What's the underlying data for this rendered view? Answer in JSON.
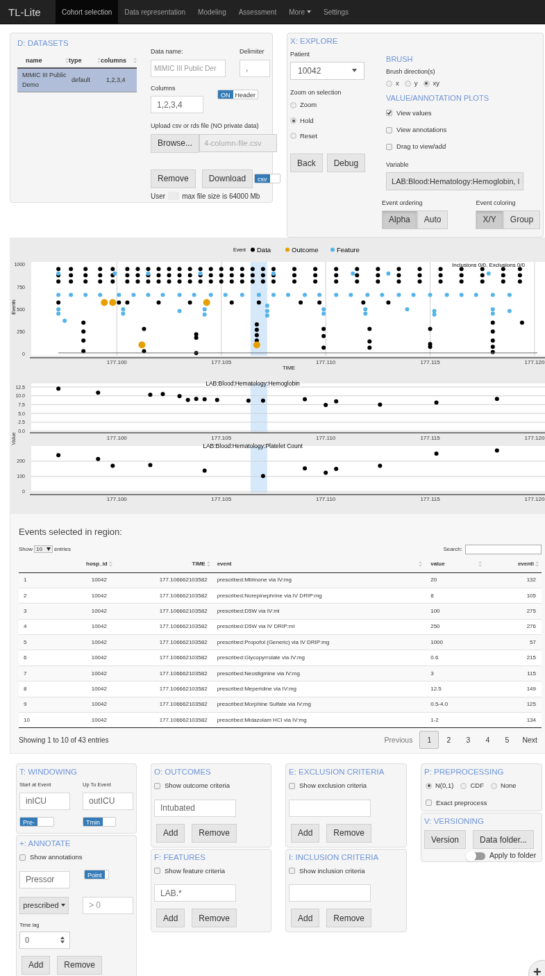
{
  "navbar": {
    "brand": "TL-Lite",
    "items": [
      {
        "label": "Cohort selection",
        "selected": true,
        "kind": "link"
      },
      {
        "label": "Data representation",
        "selected": false,
        "kind": "link"
      },
      {
        "label": "Modeling",
        "selected": false,
        "kind": "link"
      },
      {
        "label": "Assessment",
        "selected": false,
        "kind": "link"
      },
      {
        "label": "More",
        "selected": false,
        "kind": "dropdown"
      },
      {
        "label": "Settings",
        "selected": false,
        "kind": "link"
      }
    ]
  },
  "datasets": {
    "title": "D: DATASETS",
    "columns": [
      "name",
      "type",
      "columns"
    ],
    "rows": [
      {
        "cells": [
          "MIMIC III Public Demo",
          "default",
          "1,2,3,4"
        ],
        "selected": true
      }
    ],
    "data_name": {
      "label": "Data name:",
      "placeholder": "MIMIC III Public Der"
    },
    "delimiter": {
      "label": "Delimiter",
      "value": ","
    },
    "columns_field": {
      "label": "Columns",
      "value": "1,2,3,4"
    },
    "header_toggle": {
      "on_label": "ON",
      "label": "Header",
      "on": true
    },
    "upload": {
      "label": "Upload csv or rds file (NO private data)",
      "button": "Browse...",
      "placeholder": "4-column-file.csv"
    },
    "buttons": [
      "Remove",
      "Download"
    ],
    "format_toggle": {
      "label": "csv",
      "on": true
    },
    "footer": {
      "prefix": "User",
      "text": "max file size is 64000 Mb"
    }
  },
  "explore": {
    "title": "X: EXPLORE",
    "patient": {
      "label": "Patient",
      "value": "10042"
    },
    "zoom": {
      "label": "Zoom on selection",
      "options": [
        {
          "label": "Zoom",
          "selected": false
        },
        {
          "label": "Hold",
          "selected": true
        },
        {
          "label": "Reset",
          "selected": false
        }
      ]
    },
    "buttons": [
      "Back",
      "Debug"
    ],
    "brush": {
      "heading": "BRUSH",
      "label": "Brush direction(s)",
      "options": [
        {
          "label": "x",
          "selected": false
        },
        {
          "label": "y",
          "selected": false
        },
        {
          "label": "xy",
          "selected": true
        }
      ]
    },
    "plots": {
      "heading": "VALUE/ANNOTATION PLOTS",
      "checkboxes": [
        {
          "label": "View values",
          "checked": true
        },
        {
          "label": "View annotations",
          "checked": false
        },
        {
          "label": "Drag to view/add",
          "checked": false
        }
      ]
    },
    "variable": {
      "label": "Variable",
      "value": "LAB:Blood:Hematology:Hemoglobin, l"
    },
    "event_ordering": {
      "label": "Event ordering",
      "options": [
        {
          "label": "Alpha",
          "selected": true
        },
        {
          "label": "Auto",
          "selected": false
        }
      ]
    },
    "event_coloring": {
      "label": "Event coloring",
      "options": [
        {
          "label": "X/Y",
          "selected": true
        },
        {
          "label": "Group",
          "selected": false
        }
      ]
    }
  },
  "events_plot": {
    "legend_title": "Event",
    "note": "Inclusions 0/0, Exclusions 0/0",
    "chart_data": {
      "type": "scatter",
      "xlabel": "TIME",
      "ylabel": "Events",
      "xlim": [
        177.0959,
        177.1205
      ],
      "ylim": [
        -20,
        1030
      ],
      "xticks": [
        {
          "value": 177.1,
          "label": "177.100"
        },
        {
          "value": 177.105,
          "label": "177.105"
        },
        {
          "value": 177.11,
          "label": "177.110"
        },
        {
          "value": 177.115,
          "label": "177.115"
        },
        {
          "value": 177.12,
          "label": "177.120"
        }
      ],
      "yticks": [
        0,
        250,
        500,
        750,
        1000
      ],
      "grid": true,
      "legend": "top",
      "bands": [
        {
          "axis": "x",
          "from": 177.1064,
          "to": 177.1072
        }
      ],
      "series": [
        {
          "name": "Data",
          "color": "#000000",
          "x": [
            177.0972,
            177.0978,
            177.0985,
            177.0992,
            177.0998,
            177.1005,
            177.101,
            177.1015,
            177.102,
            177.1025,
            177.103,
            177.1035,
            177.104,
            177.1045,
            177.105,
            177.1055,
            177.106,
            177.1065,
            177.107,
            177.1075,
            177.1085,
            177.1095,
            177.1105,
            177.1115,
            177.1125,
            177.1135,
            177.1145,
            177.1155,
            177.1165,
            177.1175,
            177.1185,
            177.1193,
            177.0972,
            177.0978,
            177.0985,
            177.0992,
            177.0998,
            177.1005,
            177.101,
            177.1015,
            177.102,
            177.1025,
            177.103,
            177.1035,
            177.104,
            177.1045,
            177.105,
            177.1055,
            177.106,
            177.1065,
            177.107,
            177.1075,
            177.1085,
            177.1095,
            177.1105,
            177.1115,
            177.1125,
            177.1135,
            177.1145,
            177.1155,
            177.1165,
            177.1175,
            177.1185,
            177.1193,
            177.0972,
            177.0978,
            177.0985,
            177.0992,
            177.0998,
            177.1005,
            177.101,
            177.1015,
            177.102,
            177.1025,
            177.103,
            177.1035,
            177.104,
            177.1045,
            177.105,
            177.1055,
            177.106,
            177.1065,
            177.107,
            177.1075,
            177.1085,
            177.1095,
            177.1105,
            177.1115,
            177.1125,
            177.1135,
            177.1145,
            177.1155,
            177.1165,
            177.1175,
            177.1185,
            177.1193,
            177.0972,
            177.1001,
            177.1005,
            177.102,
            177.1035,
            177.1055,
            177.1068,
            177.1088,
            177.1097,
            177.1118,
            177.113,
            177.0984,
            177.0984,
            177.0984,
            177.0984,
            177.1013,
            177.1013,
            177.1038,
            177.1038,
            177.1038,
            177.1067,
            177.1067,
            177.1067,
            177.1067,
            177.1099,
            177.1099,
            177.1099,
            177.1121,
            177.1121,
            177.1121,
            177.115,
            177.115,
            177.115,
            177.118,
            177.118,
            177.118,
            177.118,
            177.118,
            177.1194
          ],
          "values": [
            950,
            950,
            950,
            950,
            950,
            950,
            950,
            950,
            950,
            950,
            950,
            950,
            950,
            950,
            950,
            950,
            950,
            950,
            950,
            950,
            950,
            950,
            950,
            950,
            950,
            950,
            950,
            950,
            950,
            950,
            950,
            950,
            880,
            880,
            880,
            880,
            880,
            880,
            880,
            880,
            880,
            880,
            880,
            880,
            880,
            880,
            880,
            880,
            880,
            880,
            880,
            880,
            880,
            880,
            880,
            880,
            880,
            880,
            880,
            880,
            880,
            880,
            880,
            880,
            810,
            810,
            810,
            810,
            810,
            810,
            810,
            810,
            810,
            810,
            810,
            810,
            810,
            810,
            810,
            810,
            810,
            810,
            810,
            810,
            810,
            810,
            810,
            810,
            810,
            810,
            810,
            810,
            810,
            810,
            810,
            810,
            575,
            575,
            575,
            575,
            575,
            575,
            575,
            575,
            575,
            575,
            575,
            350,
            250,
            150,
            30,
            280,
            30,
            220,
            180,
            10,
            330,
            270,
            210,
            150,
            280,
            200,
            70,
            280,
            140,
            70,
            280,
            110,
            80,
            350,
            250,
            150,
            80,
            20,
            350
          ]
        },
        {
          "name": "Outcome",
          "color": "#e69f00",
          "x": [
            177.0994,
            177.0998,
            177.1043,
            177.1012,
            177.1067
          ],
          "values": [
            575,
            575,
            575,
            100,
            100
          ]
        },
        {
          "name": "Feature",
          "color": "#56b4e9",
          "x": [
            177.0972,
            177.0978,
            177.0985,
            177.0992,
            177.1001,
            177.1008,
            177.1015,
            177.1022,
            177.103,
            177.1037,
            177.1045,
            177.1052,
            177.106,
            177.1068,
            177.1075,
            177.1082,
            177.109,
            177.1097,
            177.1105,
            177.1112,
            177.112,
            177.1127,
            177.1135,
            177.1142,
            177.115,
            177.1158,
            177.1165,
            177.1172,
            177.118,
            177.1188,
            177.0972,
            177.0999,
            177.1015,
            177.104,
            177.1075,
            177.1113,
            177.113,
            177.1178,
            177.0972,
            177.0972,
            177.0975,
            177.1003,
            177.1003,
            177.103,
            177.1042,
            177.1042,
            177.1072,
            177.1072,
            177.1072,
            177.1099,
            177.1099,
            177.1119,
            177.1119,
            177.1139,
            177.1152,
            177.1152,
            177.118,
            177.118,
            177.1188
          ],
          "values": [
            660,
            660,
            660,
            660,
            660,
            660,
            660,
            660,
            660,
            660,
            660,
            660,
            660,
            660,
            660,
            660,
            660,
            660,
            660,
            660,
            660,
            660,
            660,
            660,
            660,
            660,
            660,
            660,
            660,
            660,
            900,
            900,
            900,
            900,
            900,
            900,
            900,
            900,
            500,
            450,
            370,
            500,
            450,
            480,
            500,
            440,
            540,
            480,
            430,
            500,
            450,
            500,
            450,
            500,
            480,
            440,
            500,
            450,
            480
          ]
        }
      ]
    }
  },
  "value_plots": {
    "ylabel": "Value",
    "plots": [
      {
        "title": "LAB:Blood:Hematology:Hemoglobin",
        "chart_data": {
          "type": "scatter",
          "xlim": [
            177.0959,
            177.1205
          ],
          "ylim": [
            -0.3,
            13.5
          ],
          "xticks": [
            {
              "value": 177.1,
              "label": "177.100"
            },
            {
              "value": 177.105,
              "label": "177.105"
            },
            {
              "value": 177.11,
              "label": "177.110"
            },
            {
              "value": 177.115,
              "label": "177.115"
            },
            {
              "value": 177.12,
              "label": "177.120"
            }
          ],
          "yticks": [
            {
              "value": 0,
              "label": "0.0"
            },
            {
              "value": 2.5,
              "label": "2.5"
            },
            {
              "value": 5,
              "label": "5.0"
            },
            {
              "value": 7.5,
              "label": "7.5"
            },
            {
              "value": 10,
              "label": "10.0"
            },
            {
              "value": 12.5,
              "label": "12.5"
            }
          ],
          "grid": true,
          "bands": [
            {
              "axis": "x",
              "from": 177.1064,
              "to": 177.1072
            }
          ],
          "series": [
            {
              "color": "#000000",
              "x": [
                177.0972,
                177.0991,
                177.1016,
                177.1022,
                177.103,
                177.1034,
                177.1038,
                177.1042,
                177.1048,
                177.1063,
                177.107,
                177.109,
                177.11,
                177.1105,
                177.1126,
                177.1153,
                177.1182
              ],
              "values": [
                12.0,
                10.9,
                10.3,
                10.5,
                9.9,
                8.8,
                9.1,
                9.0,
                8.8,
                8.6,
                8.6,
                9.0,
                7.4,
                8.4,
                7.5,
                8.1,
                9.1
              ]
            }
          ]
        }
      },
      {
        "title": "LAB:Blood:Hematology:Platelet Count",
        "chart_data": {
          "type": "scatter",
          "xlim": [
            177.0959,
            177.1205
          ],
          "ylim": [
            -5,
            300
          ],
          "xticks": [
            {
              "value": 177.1,
              "label": "177.100"
            },
            {
              "value": 177.105,
              "label": "177.105"
            },
            {
              "value": 177.11,
              "label": "177.110"
            },
            {
              "value": 177.115,
              "label": "177.115"
            },
            {
              "value": 177.12,
              "label": "177.120"
            }
          ],
          "yticks": [
            0,
            100,
            200
          ],
          "grid": true,
          "bands": [
            {
              "axis": "x",
              "from": 177.1064,
              "to": 177.1072
            }
          ],
          "series": [
            {
              "color": "#000000",
              "x": [
                177.0972,
                177.0991,
                177.0998,
                177.1016,
                177.1042,
                177.107,
                177.109,
                177.11,
                177.1105,
                177.1126,
                177.1153,
                177.1182
              ],
              "values": [
                240,
                215,
                170,
                175,
                138,
                103,
                153,
                125,
                150,
                170,
                250,
                270
              ]
            }
          ]
        }
      }
    ]
  },
  "events_table": {
    "heading": "Events selected in region:",
    "length": {
      "show": "Show",
      "value": "10",
      "entries": "entries"
    },
    "search": {
      "label": "Search:"
    },
    "columns": [
      "",
      "hosp_id",
      "TIME",
      "event",
      "value",
      "eventi"
    ],
    "rows": [
      [
        "1",
        "10042",
        "177.106662103582",
        "prescribed:Milrinone via IV:mg",
        "20",
        "132"
      ],
      [
        "2",
        "10042",
        "177.106662103582",
        "prescribed:Norepinephrine via IV DRIP:mg",
        "8",
        "105"
      ],
      [
        "3",
        "10042",
        "177.106662103582",
        "prescribed:D5W via IV:ml",
        "100",
        "275"
      ],
      [
        "4",
        "10042",
        "177.106662103582",
        "prescribed:D5W via IV DRIP:ml",
        "250",
        "276"
      ],
      [
        "5",
        "10042",
        "177.106662103582",
        "prescribed:Propofol (Generic) via IV DRIP:mg",
        "1000",
        "57"
      ],
      [
        "6",
        "10042",
        "177.106662103582",
        "prescribed:Glycopyrrolate via IV:mg",
        "0.6",
        "215"
      ],
      [
        "7",
        "10042",
        "177.106662103582",
        "prescribed:Neostigmine via IV:mg",
        "3",
        "115"
      ],
      [
        "8",
        "10042",
        "177.106662103582",
        "prescribed:Meperidine via IV:mg",
        "12.5",
        "149"
      ],
      [
        "9",
        "10042",
        "177.106662103582",
        "prescribed:Morphine Sulfate via IV:mg",
        "0.5-4.0",
        "125"
      ],
      [
        "10",
        "10042",
        "177.106662103582",
        "prescribed:Midazolam HCl via IV:mg",
        "1-2",
        "134"
      ]
    ],
    "info": "Showing 1 to 10 of 43 entries",
    "pagination": {
      "previous": "Previous",
      "pages": [
        {
          "label": "1",
          "selected": true
        },
        {
          "label": "2",
          "selected": false
        },
        {
          "label": "3",
          "selected": false
        },
        {
          "label": "4",
          "selected": false
        },
        {
          "label": "5",
          "selected": false
        }
      ],
      "next": "Next"
    }
  },
  "windowing": {
    "title": "T: WINDOWING",
    "start": {
      "label": "Start at Event",
      "value": "inICU"
    },
    "up_to": {
      "label": "Up To Event",
      "value": "outICU"
    },
    "toggles": [
      {
        "label": "Pre-",
        "on": true
      },
      {
        "label": "Tmin",
        "on": true
      }
    ]
  },
  "annotate": {
    "title": "+: ANNOTATE",
    "show": {
      "label": "Show annotations",
      "checked": false
    },
    "name": {
      "value": "Pressor"
    },
    "point_toggle": {
      "label": "Point",
      "on": true
    },
    "source": {
      "label": "prescribed"
    },
    "condition": {
      "placeholder": "> 0"
    },
    "time_lag": {
      "label": "Time lag",
      "value": "0"
    },
    "buttons": [
      "Add",
      "Remove"
    ]
  },
  "outcomes": {
    "title": "O: OUTCOMES",
    "show": {
      "label": "Show outcome criteria",
      "checked": false
    },
    "field": {
      "value": "Intubated"
    },
    "buttons": [
      "Add",
      "Remove"
    ]
  },
  "features": {
    "title": "F: FEATURES",
    "show": {
      "label": "Show feature criteria",
      "checked": false
    },
    "field": {
      "value": "LAB.*"
    },
    "buttons": [
      "Add",
      "Remove"
    ]
  },
  "exclusion": {
    "title": "E: EXCLUSION CRITERIA",
    "show": {
      "label": "Show exclusion criteria",
      "checked": false
    },
    "buttons": [
      "Add",
      "Remove"
    ]
  },
  "inclusion": {
    "title": "I: INCLUSION CRITERIA",
    "show": {
      "label": "Show inclusion criteria",
      "checked": false
    },
    "buttons": [
      "Add",
      "Remove"
    ]
  },
  "preprocessing": {
    "title": "P: PREPROCESSING",
    "options": [
      {
        "label": "N(0,1)",
        "selected": true
      },
      {
        "label": "CDF",
        "selected": false
      },
      {
        "label": "None",
        "selected": false
      }
    ],
    "exact": {
      "label": "Exact preprocess",
      "checked": false
    }
  },
  "versioning": {
    "title": "V: VERSIONING",
    "buttons": [
      "Version",
      "Data folder..."
    ],
    "apply": {
      "label": "Apply to folder",
      "on": false
    }
  },
  "fab": {
    "label": "+"
  }
}
